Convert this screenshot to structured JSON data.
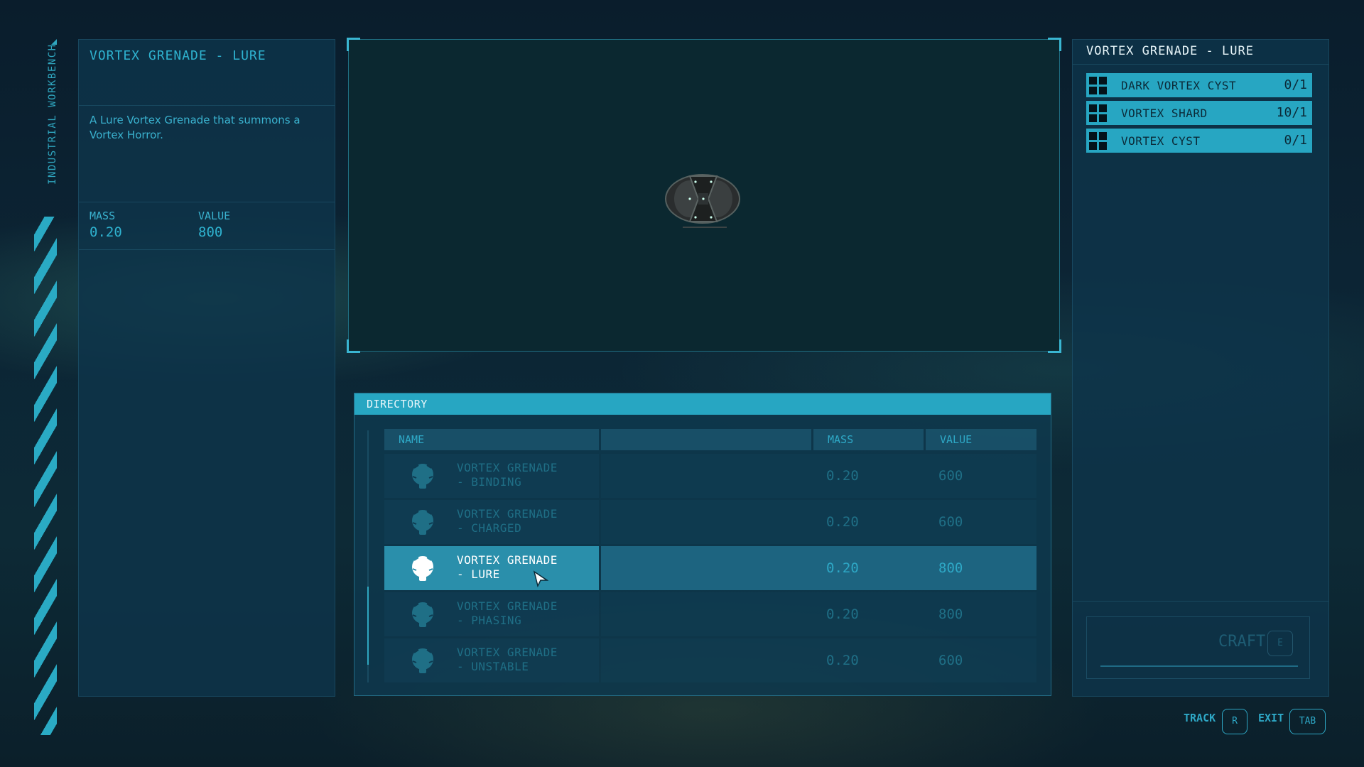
{
  "workbench": {
    "title": "INDUSTRIAL WORKBENCH"
  },
  "info": {
    "title": "VORTEX GRENADE - LURE",
    "description": "A Lure Vortex Grenade that summons a Vortex Horror.",
    "mass_label": "MASS",
    "mass_value": "0.20",
    "value_label": "VALUE",
    "value_value": "800"
  },
  "directory": {
    "title": "DIRECTORY",
    "columns": {
      "name": "NAME",
      "mass": "MASS",
      "value": "VALUE"
    },
    "rows": [
      {
        "name": "VORTEX GRENADE\n- BINDING",
        "mass": "0.20",
        "value": "600",
        "selected": false,
        "icon": "grenade-icon"
      },
      {
        "name": "VORTEX GRENADE\n- CHARGED",
        "mass": "0.20",
        "value": "600",
        "selected": false,
        "icon": "grenade-icon"
      },
      {
        "name": "VORTEX GRENADE\n- LURE",
        "mass": "0.20",
        "value": "800",
        "selected": true,
        "icon": "grenade-icon"
      },
      {
        "name": "VORTEX GRENADE\n- PHASING",
        "mass": "0.20",
        "value": "800",
        "selected": false,
        "icon": "grenade-icon"
      },
      {
        "name": "VORTEX GRENADE\n- UNSTABLE",
        "mass": "0.20",
        "value": "600",
        "selected": false,
        "icon": "grenade-icon"
      }
    ]
  },
  "requirements": {
    "title": "VORTEX GRENADE - LURE",
    "materials": [
      {
        "name": "DARK VORTEX CYST",
        "count": "0/1"
      },
      {
        "name": "VORTEX SHARD",
        "count": "10/1"
      },
      {
        "name": "VORTEX CYST",
        "count": "0/1"
      }
    ],
    "craft_label": "CRAFT",
    "craft_key": "E"
  },
  "hints": {
    "track_label": "TRACK",
    "track_key": "R",
    "exit_label": "EXIT",
    "exit_key": "TAB"
  },
  "colors": {
    "accent": "#27a6c2",
    "text_accent": "#2fb3d0",
    "panel": "#0e344a"
  }
}
